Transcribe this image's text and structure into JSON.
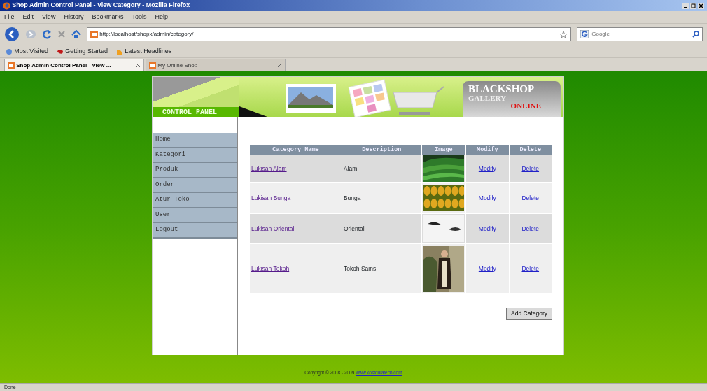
{
  "window": {
    "title": "Shop Admin Control Panel - View Category - Mozilla Firefox"
  },
  "menu": [
    "File",
    "Edit",
    "View",
    "History",
    "Bookmarks",
    "Tools",
    "Help"
  ],
  "address": {
    "value": "http://localhost/shopx/admin/category/"
  },
  "search": {
    "placeholder": "Google"
  },
  "bookmarks": [
    "Most Visited",
    "Getting Started",
    "Latest Headlines"
  ],
  "tabs": [
    {
      "label": "Shop Admin Control Panel - View ...",
      "selected": true
    },
    {
      "label": "My Online Shop",
      "selected": false
    }
  ],
  "header": {
    "panel_label": "CONTROL PANEL",
    "logo_title": "BLACKSHOP",
    "logo_subtitle": "GALLERY",
    "logo_tag": "ONLINE"
  },
  "sidebar": {
    "items": [
      "Home",
      "Kategori",
      "Produk",
      "Order",
      "Atur Toko",
      "User",
      "Logout"
    ]
  },
  "table": {
    "columns": [
      "Category Name",
      "Description",
      "Image",
      "Modify",
      "Delete"
    ],
    "rows": [
      {
        "name": "Lukisan Alam",
        "description": "Alam",
        "modify": "Modify",
        "delete": "Delete"
      },
      {
        "name": "Lukisan Bunga",
        "description": "Bunga",
        "modify": "Modify",
        "delete": "Delete"
      },
      {
        "name": "Lukisan Oriental",
        "description": "Oriental",
        "modify": "Modify",
        "delete": "Delete"
      },
      {
        "name": "Lukisan Tokoh",
        "description": "Tokoh Sains",
        "modify": "Modify",
        "delete": "Delete"
      }
    ]
  },
  "add_button": "Add Category",
  "footer": {
    "text": "Copyright © 2008 - 2009",
    "link": "www.kostdulatech.com"
  },
  "status_bar": "Done"
}
